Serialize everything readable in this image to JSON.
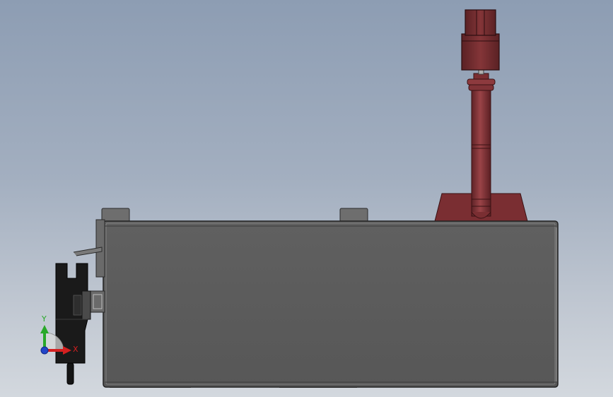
{
  "triad": {
    "x_label": "X",
    "y_label": "Y"
  },
  "colors": {
    "viewport_top": "#8d9db3",
    "viewport_bottom": "#d3d8de",
    "housing_face": "#5b5b5b",
    "housing_edge": "#2a2a2a",
    "probe_rod": "#8f3b3f",
    "probe_base": "#7a2e32",
    "axis_x": "#d42020",
    "axis_y": "#29a829",
    "axis_z": "#2345c8"
  }
}
